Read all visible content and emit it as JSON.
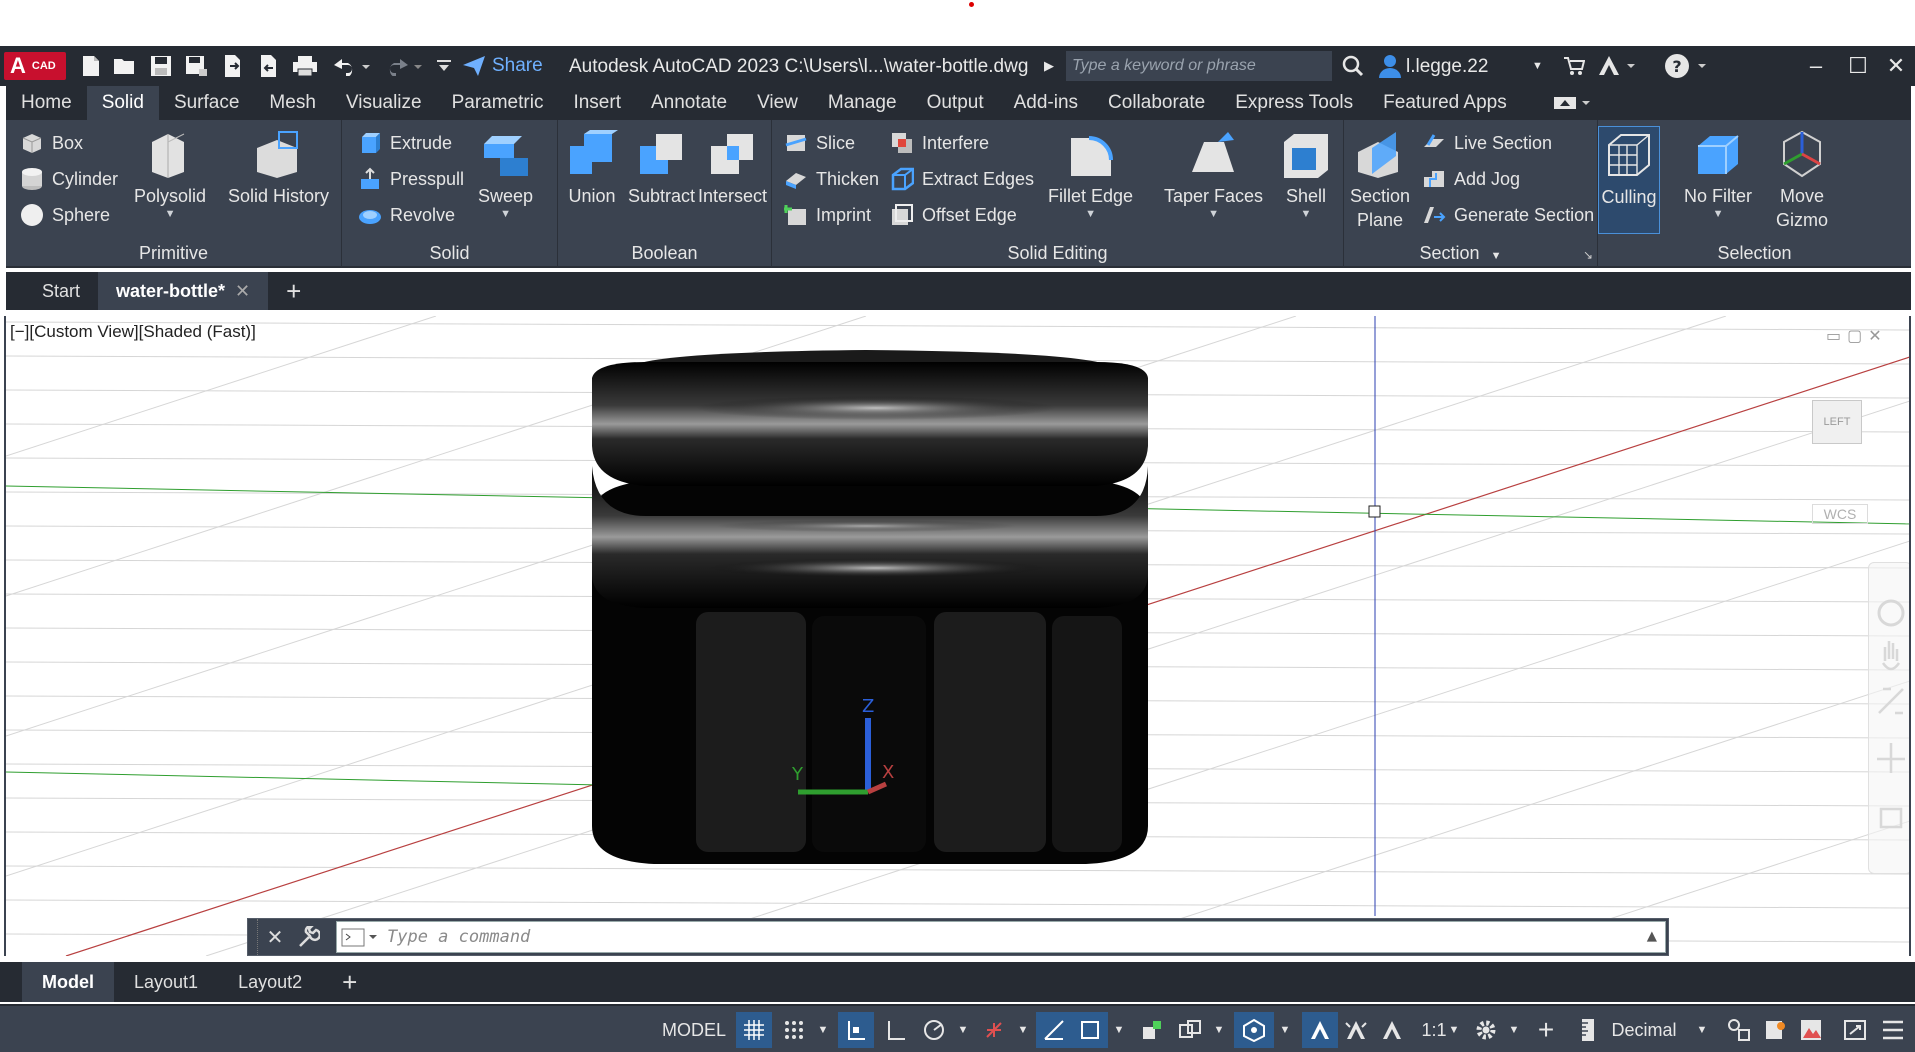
{
  "titlebar": {
    "app_badge": "A",
    "app_badge_sub": "CAD",
    "share_label": "Share",
    "window_title": "Autodesk AutoCAD 2023   C:\\Users\\l...\\water-bottle.dwg",
    "search_placeholder": "Type a keyword or phrase",
    "user_name": "l.legge.22",
    "icons": [
      "new-icon",
      "open-icon",
      "save-icon",
      "save-as-icon",
      "open-web-icon",
      "save-web-icon",
      "plot-icon",
      "undo-icon",
      "redo-icon",
      "customize-icon",
      "share-icon",
      "search-icon",
      "user-icon",
      "cart-icon",
      "autodesk-account-icon",
      "help-icon"
    ]
  },
  "ribbon_tabs": [
    "Home",
    "Solid",
    "Surface",
    "Mesh",
    "Visualize",
    "Parametric",
    "Insert",
    "Annotate",
    "View",
    "Manage",
    "Output",
    "Add-ins",
    "Collaborate",
    "Express Tools",
    "Featured Apps"
  ],
  "ribbon_active_tab": "Solid",
  "panels": {
    "primitive": {
      "title": "Primitive",
      "box": "Box",
      "cylinder": "Cylinder",
      "sphere": "Sphere",
      "polysolid": "Polysolid",
      "solid_history": "Solid History"
    },
    "solid": {
      "title": "Solid",
      "extrude": "Extrude",
      "presspull": "Presspull",
      "revolve": "Revolve",
      "sweep": "Sweep"
    },
    "boolean": {
      "title": "Boolean",
      "union": "Union",
      "subtract": "Subtract",
      "intersect": "Intersect"
    },
    "solid_editing": {
      "title": "Solid Editing",
      "slice": "Slice",
      "thicken": "Thicken",
      "imprint": "Imprint",
      "interfere": "Interfere",
      "extract_edges": "Extract Edges",
      "offset_edge": "Offset Edge",
      "fillet_edge": "Fillet Edge",
      "taper_faces": "Taper Faces",
      "shell": "Shell"
    },
    "section": {
      "title": "Section",
      "section_plane_1": "Section",
      "section_plane_2": "Plane",
      "live_section": "Live Section",
      "add_jog": "Add Jog",
      "generate_section": "Generate Section"
    },
    "selection": {
      "title": "Selection",
      "culling": "Culling",
      "no_filter": "No Filter",
      "move_gizmo_1": "Move",
      "move_gizmo_2": "Gizmo"
    }
  },
  "doc_tabs": {
    "start": "Start",
    "active": "water-bottle*"
  },
  "viewport": {
    "label": "[−][Custom View][Shaded (Fast)]",
    "viewcube": "LEFT",
    "ucs": "WCS",
    "axis_labels": {
      "x": "X",
      "y": "Y",
      "z": "Z"
    },
    "colors": {
      "x_axis": "#b84040",
      "y_axis": "#2f9e2f",
      "z_axis": "#2b5fd9",
      "grid": "#d4d4d4",
      "model": "#050505"
    }
  },
  "command_line": {
    "placeholder": "Type a command"
  },
  "layout_tabs": [
    "Model",
    "Layout1",
    "Layout2"
  ],
  "statusbar": {
    "model": "MODEL",
    "scale": "1:1",
    "units": "Decimal"
  }
}
